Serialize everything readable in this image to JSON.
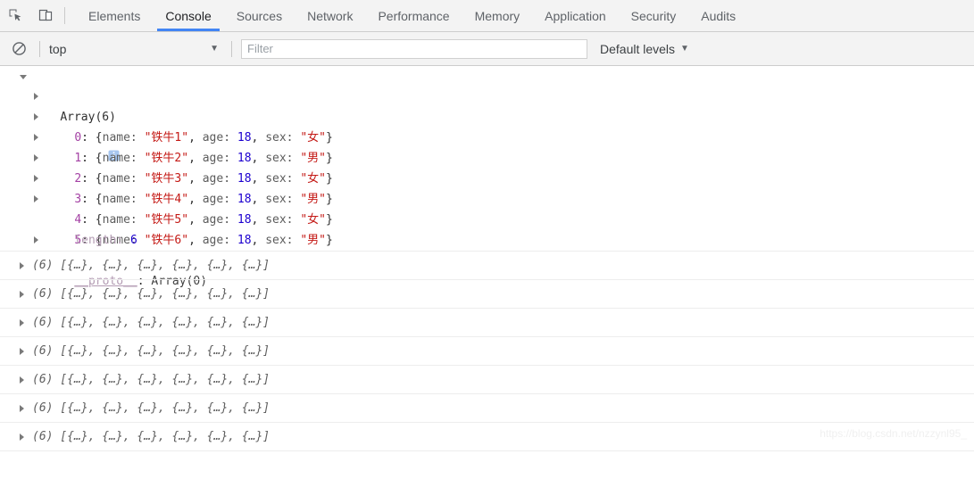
{
  "tabbar": {
    "inspect_icon": "inspect-cursor-icon",
    "device_icon": "device-toolbar-icon",
    "tabs": [
      {
        "label": "Elements",
        "active": false
      },
      {
        "label": "Console",
        "active": true
      },
      {
        "label": "Sources",
        "active": false
      },
      {
        "label": "Network",
        "active": false
      },
      {
        "label": "Performance",
        "active": false
      },
      {
        "label": "Memory",
        "active": false
      },
      {
        "label": "Application",
        "active": false
      },
      {
        "label": "Security",
        "active": false
      },
      {
        "label": "Audits",
        "active": false
      }
    ]
  },
  "toolbar": {
    "clear_icon": "clear-console-icon",
    "context": "top",
    "context_caret": "▼",
    "filter_value": "",
    "filter_placeholder": "Filter",
    "levels_label": "Default levels",
    "levels_caret": "▼"
  },
  "console": {
    "group": {
      "header": "Array(6)",
      "info_icon": "info-icon",
      "entries": [
        {
          "index": "0",
          "open_brace": ": {",
          "k_name": "name: ",
          "v_name": "\"铁牛1\"",
          "sep1": ", ",
          "k_age": "age: ",
          "v_age": "18",
          "sep2": ", ",
          "k_sex": "sex: ",
          "v_sex": "\"女\"",
          "close_brace": "}"
        },
        {
          "index": "1",
          "open_brace": ": {",
          "k_name": "name: ",
          "v_name": "\"铁牛2\"",
          "sep1": ", ",
          "k_age": "age: ",
          "v_age": "18",
          "sep2": ", ",
          "k_sex": "sex: ",
          "v_sex": "\"男\"",
          "close_brace": "}"
        },
        {
          "index": "2",
          "open_brace": ": {",
          "k_name": "name: ",
          "v_name": "\"铁牛3\"",
          "sep1": ", ",
          "k_age": "age: ",
          "v_age": "18",
          "sep2": ", ",
          "k_sex": "sex: ",
          "v_sex": "\"女\"",
          "close_brace": "}"
        },
        {
          "index": "3",
          "open_brace": ": {",
          "k_name": "name: ",
          "v_name": "\"铁牛4\"",
          "sep1": ", ",
          "k_age": "age: ",
          "v_age": "18",
          "sep2": ", ",
          "k_sex": "sex: ",
          "v_sex": "\"男\"",
          "close_brace": "}"
        },
        {
          "index": "4",
          "open_brace": ": {",
          "k_name": "name: ",
          "v_name": "\"铁牛5\"",
          "sep1": ", ",
          "k_age": "age: ",
          "v_age": "18",
          "sep2": ", ",
          "k_sex": "sex: ",
          "v_sex": "\"女\"",
          "close_brace": "}"
        },
        {
          "index": "5",
          "open_brace": ": {",
          "k_name": "name: ",
          "v_name": "\"铁牛6\"",
          "sep1": ", ",
          "k_age": "age: ",
          "v_age": "18",
          "sep2": ", ",
          "k_sex": "sex: ",
          "v_sex": "\"男\"",
          "close_brace": "}"
        }
      ],
      "length_key": "length: ",
      "length_value": "6",
      "proto_key": "__proto__",
      "proto_sep": ": ",
      "proto_value": "Array(0)"
    },
    "collapsed_rows": [
      {
        "count": "(6)",
        "preview": " [{…}, {…}, {…}, {…}, {…}, {…}]"
      },
      {
        "count": "(6)",
        "preview": " [{…}, {…}, {…}, {…}, {…}, {…}]"
      },
      {
        "count": "(6)",
        "preview": " [{…}, {…}, {…}, {…}, {…}, {…}]"
      },
      {
        "count": "(6)",
        "preview": " [{…}, {…}, {…}, {…}, {…}, {…}]"
      },
      {
        "count": "(6)",
        "preview": " [{…}, {…}, {…}, {…}, {…}, {…}]"
      },
      {
        "count": "(6)",
        "preview": " [{…}, {…}, {…}, {…}, {…}, {…}]"
      },
      {
        "count": "(6)",
        "preview": " [{…}, {…}, {…}, {…}, {…}, {…}]"
      }
    ],
    "prompt_chevron": "❯"
  },
  "watermark": "https://blog.csdn.net/nzzynl95_",
  "colors": {
    "accent": "#4285f4",
    "string": "#c41a16",
    "number": "#1c00cf",
    "index": "#a441a4",
    "dim": "#b39bb3",
    "toolbar_bg": "#f3f3f3"
  }
}
